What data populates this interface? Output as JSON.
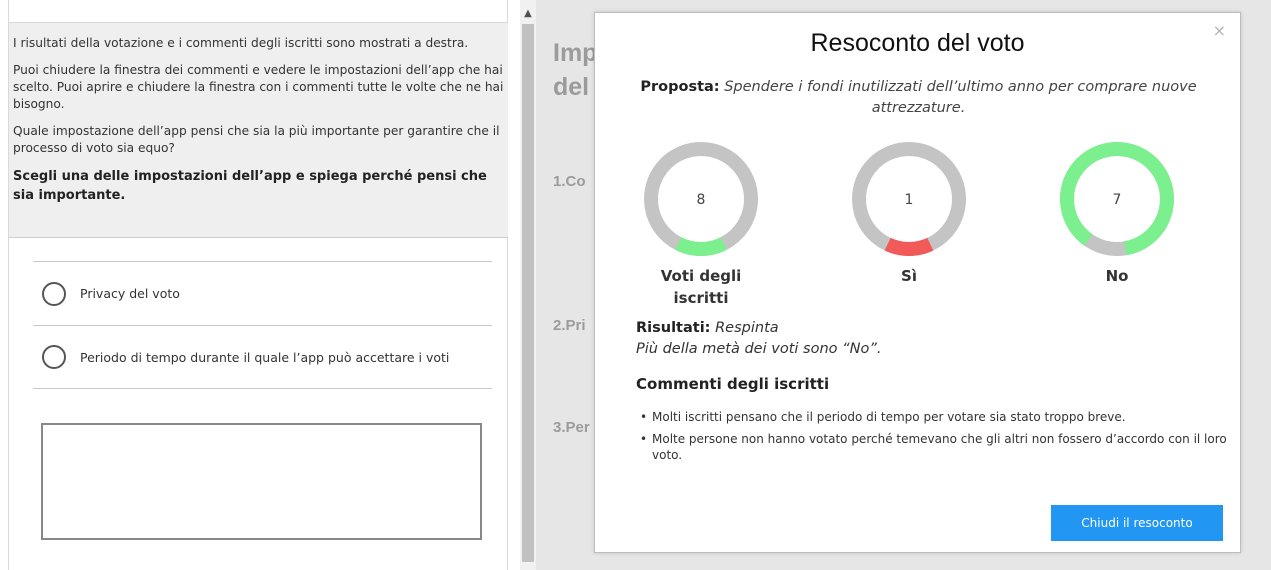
{
  "left": {
    "paragraphs": [
      "I risultati della votazione e i commenti degli iscritti sono mostrati a destra.",
      "Puoi chiudere la finestra dei commenti e vedere le impostazioni dell’app che hai scelto. Puoi aprire e chiudere la finestra con i commenti tutte le volte che ne hai bisogno.",
      "Quale impostazione dell’app pensi che sia la più importante per garantire che il processo di voto sia equo?"
    ],
    "instruction": "Scegli una delle impostazioni dell’app e spiega perché pensi che sia importante.",
    "options": [
      "Privacy del voto",
      "Periodo di tempo durante il quale l’app può accettare i voti"
    ],
    "answer_value": ""
  },
  "background": {
    "title_lines": [
      "Imp",
      "del"
    ],
    "items": [
      "1.Co",
      "2.Pri",
      "3.Per"
    ]
  },
  "modal": {
    "close_icon": "×",
    "title": "Resoconto del voto",
    "proposal_label": "Proposta:",
    "proposal_text": "Spendere i fondi inutilizzati dell’ultimo anno per comprare nuove attrezzature.",
    "charts": [
      {
        "value": "8",
        "label": "Voti degli iscritti",
        "fraction": 0.15,
        "color": "#7cf08f"
      },
      {
        "value": "1",
        "label": "Sì",
        "fraction": 0.14,
        "color": "#f25a5a"
      },
      {
        "value": "7",
        "label": "No",
        "fraction": 0.875,
        "color": "#7cf08f"
      }
    ],
    "track_color": "#c4c4c4",
    "results_label": "Risultati:",
    "results_value": "Respinta",
    "results_note": "Più della metà dei voti sono “No”.",
    "comments_title": "Commenti degli iscritti",
    "comments": [
      "Molti iscritti pensano che il periodo di tempo per votare sia stato troppo breve.",
      "Molte persone non hanno votato perché temevano che gli altri non fossero d’accordo con il loro voto."
    ],
    "close_button": "Chiudi il resoconto",
    "accent": "#2196f3"
  }
}
